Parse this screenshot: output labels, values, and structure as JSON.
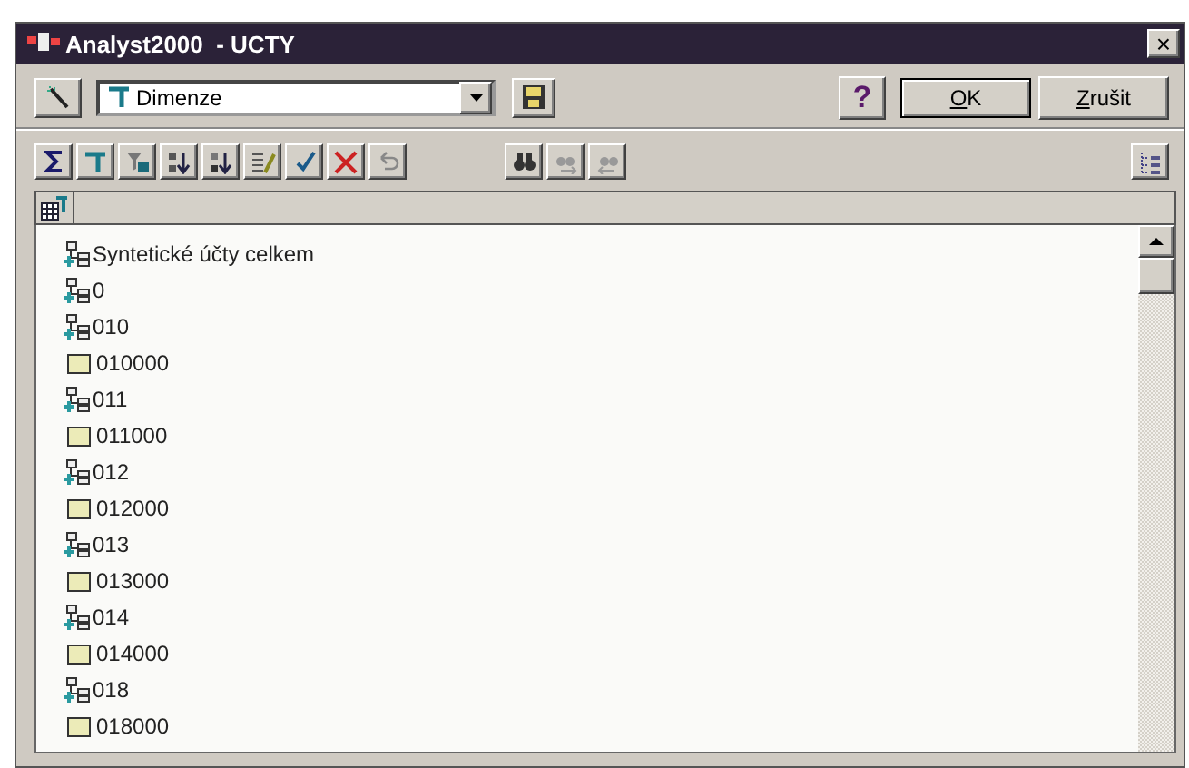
{
  "window": {
    "title": "Analyst2000  - UCTY",
    "close": "×"
  },
  "top_bar": {
    "dimension_select": {
      "value": "Dimenze"
    },
    "help": "?",
    "ok": "OK",
    "cancel": "Zrušit"
  },
  "tree": [
    {
      "kind": "group",
      "label": "Syntetické účty celkem"
    },
    {
      "kind": "group",
      "label": "0"
    },
    {
      "kind": "group",
      "label": "010"
    },
    {
      "kind": "leaf",
      "label": "010000"
    },
    {
      "kind": "group",
      "label": "011"
    },
    {
      "kind": "leaf",
      "label": "011000"
    },
    {
      "kind": "group",
      "label": "012"
    },
    {
      "kind": "leaf",
      "label": "012000"
    },
    {
      "kind": "group",
      "label": "013"
    },
    {
      "kind": "leaf",
      "label": "013000"
    },
    {
      "kind": "group",
      "label": "014"
    },
    {
      "kind": "leaf",
      "label": "014000"
    },
    {
      "kind": "group",
      "label": "018"
    },
    {
      "kind": "leaf",
      "label": "018000"
    }
  ]
}
